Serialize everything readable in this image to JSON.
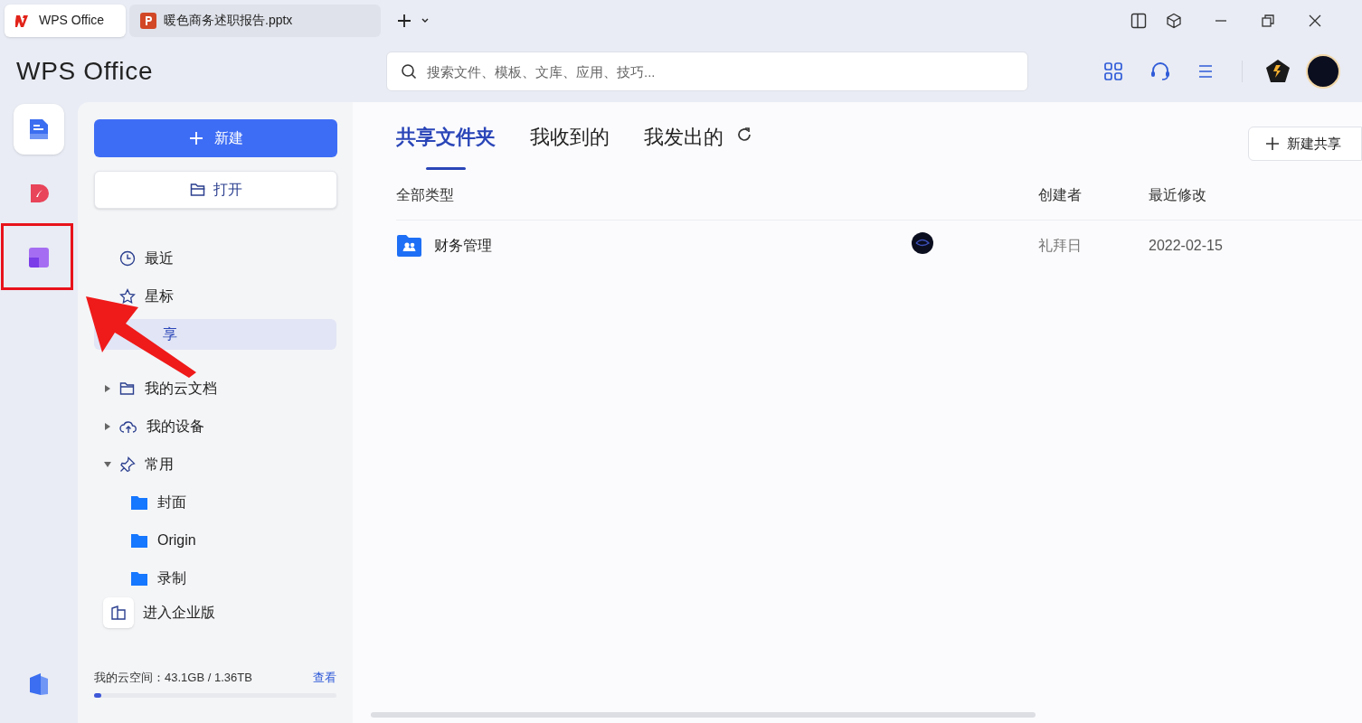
{
  "tabs": [
    {
      "label": "WPS Office",
      "kind": "home",
      "selected": true
    },
    {
      "label": "暖色商务述职报告.pptx",
      "kind": "ppt",
      "selected": false
    }
  ],
  "header": {
    "logo": "WPS Office",
    "search": {
      "placeholder": "搜索文件、模板、文库、应用、技巧..."
    }
  },
  "rail": [
    {
      "kind": "docs",
      "selected": true
    },
    {
      "kind": "pdf",
      "selected": false
    },
    {
      "kind": "apps",
      "selected": false
    }
  ],
  "sidebar": {
    "new_button": "新建",
    "open_button": "打开",
    "nav": [
      {
        "label": "最近",
        "kind": "clock",
        "selected": false
      },
      {
        "label": "星标",
        "kind": "star",
        "selected": false
      },
      {
        "label": "享",
        "kind": "plain",
        "selected": true
      }
    ],
    "tree": [
      {
        "label": "我的云文档",
        "kind": "folder",
        "expanded": false
      },
      {
        "label": "我的设备",
        "kind": "cloud",
        "expanded": false
      },
      {
        "label": "常用",
        "kind": "pin",
        "expanded": true,
        "children": [
          {
            "label": "封面"
          },
          {
            "label": "Origin"
          },
          {
            "label": "录制"
          }
        ]
      }
    ],
    "enterprise": "进入企业版",
    "storage": {
      "label": "我的云空间：43.1GB / 1.36TB",
      "link": "查看",
      "level": 0.03
    }
  },
  "main": {
    "tabs": [
      {
        "label": "共享文件夹",
        "selected": true
      },
      {
        "label": "我收到的",
        "selected": false
      },
      {
        "label": "我发出的",
        "selected": false
      }
    ],
    "new_share_button": "新建共享",
    "columns": [
      "全部类型",
      "创建者",
      "最近修改"
    ],
    "rows": [
      {
        "name": "财务管理",
        "creator": "礼拜日",
        "modified": "2022-02-15"
      }
    ]
  },
  "annotations": [
    {
      "kind": "box"
    },
    {
      "kind": "arrow"
    }
  ]
}
